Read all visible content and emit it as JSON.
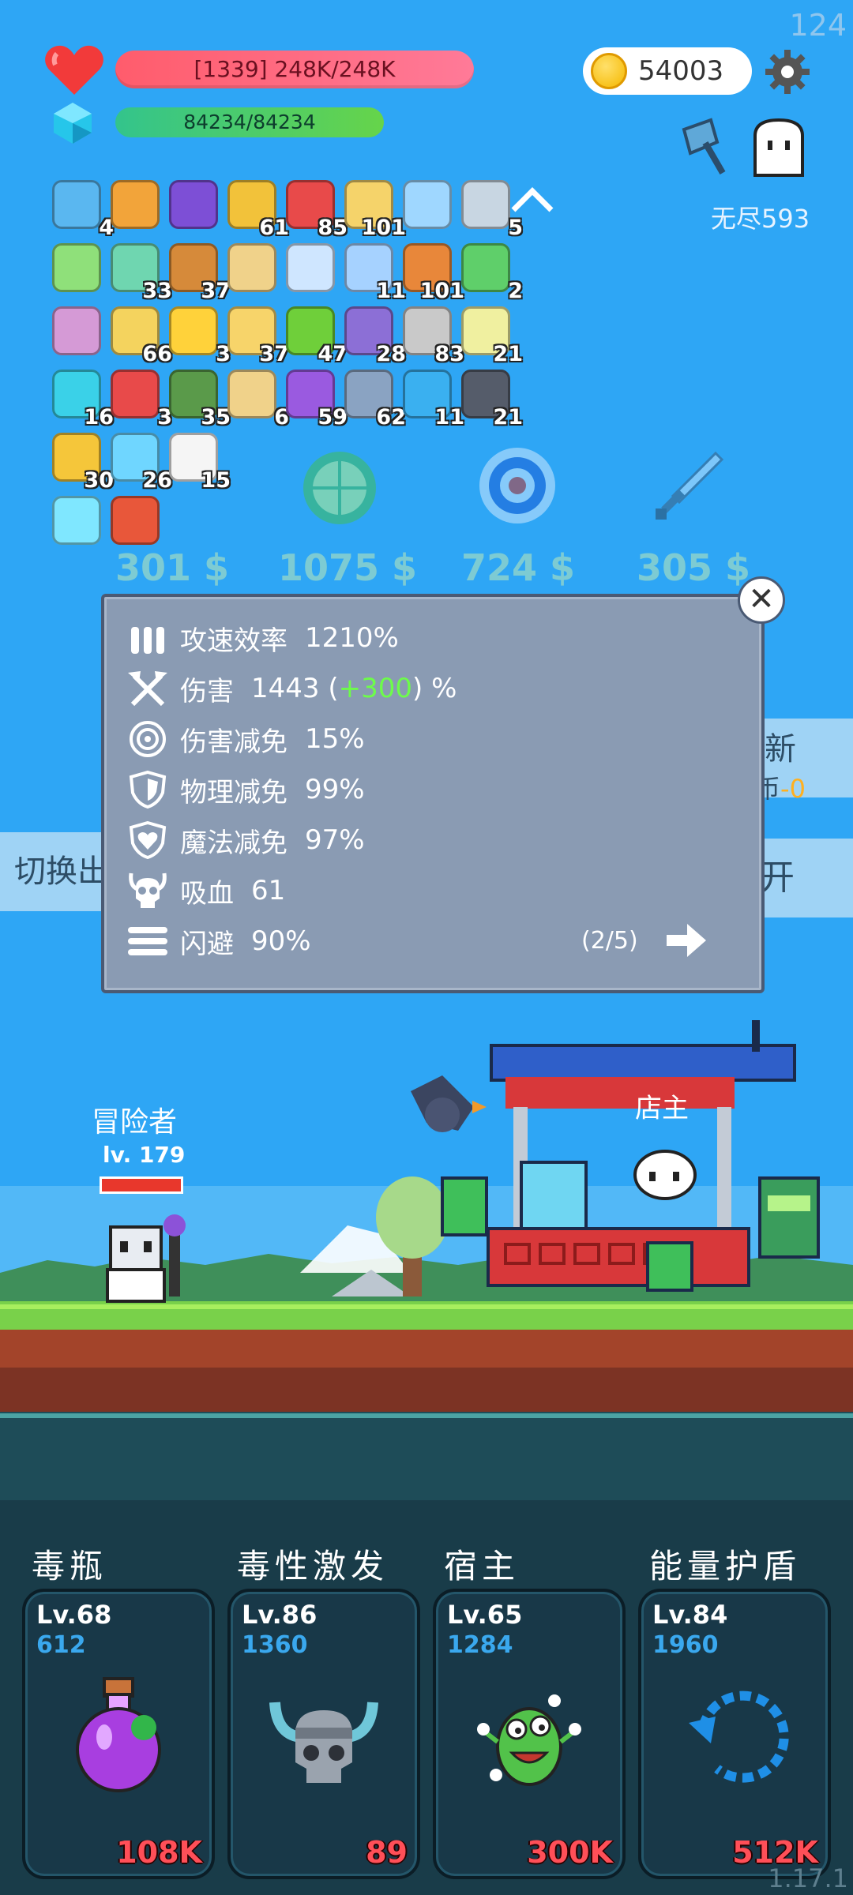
{
  "fps": "124",
  "player": {
    "hp_text": "[1339] 248K/248K",
    "mp_text": "84234/84234",
    "coins": "54003",
    "endless_label": "无尽593"
  },
  "items": [
    {
      "icon": "star-card-icon",
      "count": "4"
    },
    {
      "icon": "open-book-icon",
      "count": ""
    },
    {
      "icon": "wizard-hat-icon",
      "count": ""
    },
    {
      "icon": "pineapple-icon",
      "count": "61"
    },
    {
      "icon": "mushroom-icon",
      "count": "85"
    },
    {
      "icon": "bee-swarm-icon",
      "count": "101"
    },
    {
      "icon": "blank-tile-icon",
      "count": ""
    },
    {
      "icon": "target-disc-icon",
      "count": "5"
    },
    {
      "icon": "green-card-icon",
      "count": ""
    },
    {
      "icon": "green-spirit-icon",
      "count": "33"
    },
    {
      "icon": "crossbow-icon",
      "count": "37"
    },
    {
      "icon": "scroll-icon",
      "count": ""
    },
    {
      "icon": "speed-lines-icon",
      "count": ""
    },
    {
      "icon": "shirt-icon",
      "count": "11"
    },
    {
      "icon": "briefcase-icon",
      "count": "101"
    },
    {
      "icon": "cash-heart-icon",
      "count": "2"
    },
    {
      "icon": "crystal-ball-icon",
      "count": ""
    },
    {
      "icon": "quill-note-icon",
      "count": "66"
    },
    {
      "icon": "sun-orb-icon",
      "count": "3"
    },
    {
      "icon": "cheese-icon",
      "count": "37"
    },
    {
      "icon": "lime-icon",
      "count": "47"
    },
    {
      "icon": "star-shield-icon",
      "count": "28"
    },
    {
      "icon": "hook-icon",
      "count": "83"
    },
    {
      "icon": "halo-icon",
      "count": "21"
    },
    {
      "icon": "spiral-icon",
      "count": "16"
    },
    {
      "icon": "percent-card-icon",
      "count": "3"
    },
    {
      "icon": "grenade-icon",
      "count": "35"
    },
    {
      "icon": "treasure-map-icon",
      "count": "6"
    },
    {
      "icon": "purple-chest-icon",
      "count": "59"
    },
    {
      "icon": "steel-shield-icon",
      "count": "62"
    },
    {
      "icon": "blue-gem-icon",
      "count": "11"
    },
    {
      "icon": "spellbook-icon",
      "count": "21"
    },
    {
      "icon": "magic-wand-icon",
      "count": "30"
    },
    {
      "icon": "ice-cream-icon",
      "count": "26"
    },
    {
      "icon": "clipboard-icon",
      "count": "15"
    },
    {
      "icon": "light-card-icon",
      "count": ""
    },
    {
      "icon": "fire-card-icon",
      "count": ""
    }
  ],
  "shop": {
    "prices": [
      "301 $",
      "1075 $",
      "724 $",
      "305 $"
    ],
    "items": [
      "lime-icon",
      "target-icon",
      "dagger-icon"
    ]
  },
  "stats_panel": {
    "rows": [
      {
        "icon": "bullets-icon",
        "label": "攻速效率",
        "value": "1210%"
      },
      {
        "icon": "crossed-axes-icon",
        "label": "伤害",
        "value_pre": "1443 (",
        "value_bonus": "+300",
        "value_post": ") %"
      },
      {
        "icon": "target-rings-icon",
        "label": "伤害减免",
        "value": "15%"
      },
      {
        "icon": "shield-icon",
        "label": "物理减免",
        "value": "99%"
      },
      {
        "icon": "heart-shield-icon",
        "label": "魔法减免",
        "value": "97%"
      },
      {
        "icon": "horned-skull-icon",
        "label": "吸血",
        "value": "61"
      },
      {
        "icon": "dash-lines-icon",
        "label": "闪避",
        "value": "90%"
      }
    ],
    "pager": "(2/5)"
  },
  "side": {
    "left": "切换出",
    "right_top": "新",
    "right_mid_prefix": "币",
    "right_mid_value": "-0",
    "right_bottom": "开"
  },
  "scene": {
    "hero_label": "冒险者",
    "hero_level": "lv. 179",
    "shop_label": "店主"
  },
  "skills": [
    {
      "name": "毒瓶",
      "level": "Lv.68",
      "power": "612",
      "cost": "108K",
      "icon": "potion-icon"
    },
    {
      "name": "毒性激发",
      "level": "Lv.86",
      "power": "1360",
      "cost": "89",
      "icon": "viking-skull-icon"
    },
    {
      "name": "宿主",
      "level": "Lv.65",
      "power": "1284",
      "cost": "300K",
      "icon": "green-monster-icon"
    },
    {
      "name": "能量护盾",
      "level": "Lv.84",
      "power": "1960",
      "cost": "512K",
      "icon": "refresh-arc-icon"
    }
  ],
  "version": "1.17.1",
  "colors": {
    "sky": "#2ea6f5",
    "hp_bar": "#ff6f8a",
    "mp_bar": "#4ccc6a",
    "panel": "#8a9bb3",
    "skill_cost": "#ff4f58",
    "skill_power": "#3aa8ee",
    "bonus_green": "#6dfc4a"
  }
}
